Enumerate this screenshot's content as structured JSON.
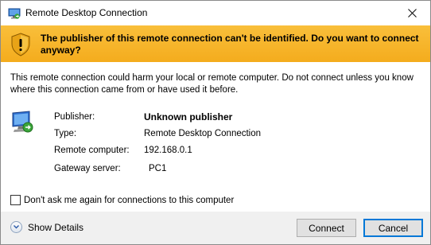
{
  "window": {
    "title": "Remote Desktop Connection"
  },
  "banner": {
    "message": "The publisher of this remote connection can't be identified. Do you want to connect anyway?"
  },
  "content": {
    "description": "This remote connection could harm your local or remote computer. Do not connect unless you know where this connection came from or have used it before.",
    "details": [
      {
        "label": "Publisher:",
        "value": "Unknown publisher"
      },
      {
        "label": "Type:",
        "value": "Remote Desktop Connection"
      },
      {
        "label": "Remote computer:",
        "value": "192.168.0.1"
      },
      {
        "label": "Gateway server:",
        "value": "PC1"
      }
    ],
    "checkbox_label": "Don't ask me again for connections to this computer",
    "checkbox_checked": false
  },
  "footer": {
    "show_details_label": "Show Details",
    "connect_label": "Connect",
    "cancel_label": "Cancel"
  },
  "colors": {
    "banner": "#f7b32b",
    "accent": "#0078d7"
  }
}
